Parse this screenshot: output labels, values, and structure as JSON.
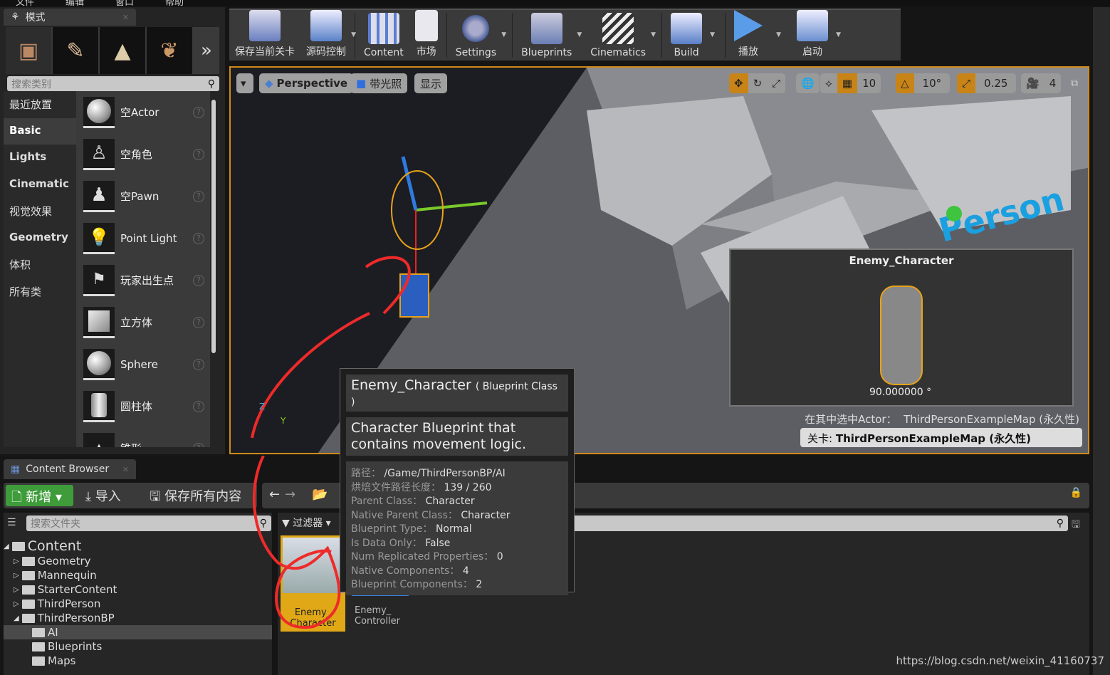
{
  "menubar": [
    "文件",
    "编辑",
    "窗口",
    "帮助"
  ],
  "modes": {
    "tab": "模式",
    "search_placeholder": "搜索类别",
    "categories": [
      "最近放置",
      "Basic",
      "Lights",
      "Cinematic",
      "视觉效果",
      "Geometry",
      "体积",
      "所有类"
    ],
    "selected_category": "Basic",
    "items": [
      "空Actor",
      "空角色",
      "空Pawn",
      "Point Light",
      "玩家出生点",
      "立方体",
      "Sphere",
      "圆柱体",
      "锥形"
    ]
  },
  "toolbar": [
    {
      "label": "保存当前关卡",
      "icon": "save-icon"
    },
    {
      "label": "源码控制",
      "icon": "source-control-icon"
    },
    {
      "label": "Content",
      "icon": "content-icon"
    },
    {
      "label": "市场",
      "icon": "marketplace-icon"
    },
    {
      "label": "Settings",
      "icon": "settings-icon"
    },
    {
      "label": "Blueprints",
      "icon": "blueprints-icon"
    },
    {
      "label": "Cinematics",
      "icon": "cinematics-icon"
    },
    {
      "label": "Build",
      "icon": "build-icon"
    },
    {
      "label": "播放",
      "icon": "play-icon"
    },
    {
      "label": "启动",
      "icon": "launch-icon"
    }
  ],
  "viewport": {
    "perspective": "Perspective",
    "lit": "带光照",
    "show": "显示",
    "grid_snap": "10",
    "rot_snap": "10°",
    "scale_snap": "0.25",
    "camera_speed": "4",
    "preview_title": "Enemy_Character",
    "preview_angle": "90.000000 °",
    "selected_actor_label": "在其中选中Actor：",
    "selected_actor_value": "ThirdPersonExampleMap (永久性)",
    "level_label": "关卡:",
    "level_value": "ThirdPersonExampleMap (永久性)"
  },
  "tooltip": {
    "name": "Enemy_Character",
    "type": "( Blueprint Class )",
    "description": "Character Blueprint that contains movement logic.",
    "props": [
      [
        "路径：",
        "/Game/ThirdPersonBP/AI"
      ],
      [
        "烘焙文件路径长度：",
        "139 / 260"
      ],
      [
        "Parent Class：",
        "Character"
      ],
      [
        "Native Parent Class：",
        "Character"
      ],
      [
        "Blueprint Type：",
        "Normal"
      ],
      [
        "Is Data Only：",
        "False"
      ],
      [
        "Num Replicated Properties：",
        "0"
      ],
      [
        "Native Components：",
        "4"
      ],
      [
        "Blueprint Components：",
        "2"
      ]
    ]
  },
  "content_browser": {
    "tab": "Content Browser",
    "new": "新增",
    "import": "导入",
    "save_all": "保存所有内容",
    "folder_search_placeholder": "搜索文件夹",
    "filters": "过滤器",
    "tree": [
      {
        "label": "Content",
        "level": 0
      },
      {
        "label": "Geometry",
        "level": 1
      },
      {
        "label": "Mannequin",
        "level": 1
      },
      {
        "label": "StarterContent",
        "level": 1
      },
      {
        "label": "ThirdPerson",
        "level": 1
      },
      {
        "label": "ThirdPersonBP",
        "level": 1
      },
      {
        "label": "AI",
        "level": 2,
        "selected": true
      },
      {
        "label": "Blueprints",
        "level": 2
      },
      {
        "label": "Maps",
        "level": 2
      }
    ],
    "assets": [
      {
        "label": "Enemy_ Character",
        "selected": true
      },
      {
        "label": "Enemy_ Controller"
      }
    ]
  },
  "watermark": "https://blog.csdn.net/weixin_41160737",
  "colors": {
    "accent": "#d08a18",
    "new_button": "#3e9c3a",
    "annotation": "#ee2a2a"
  }
}
